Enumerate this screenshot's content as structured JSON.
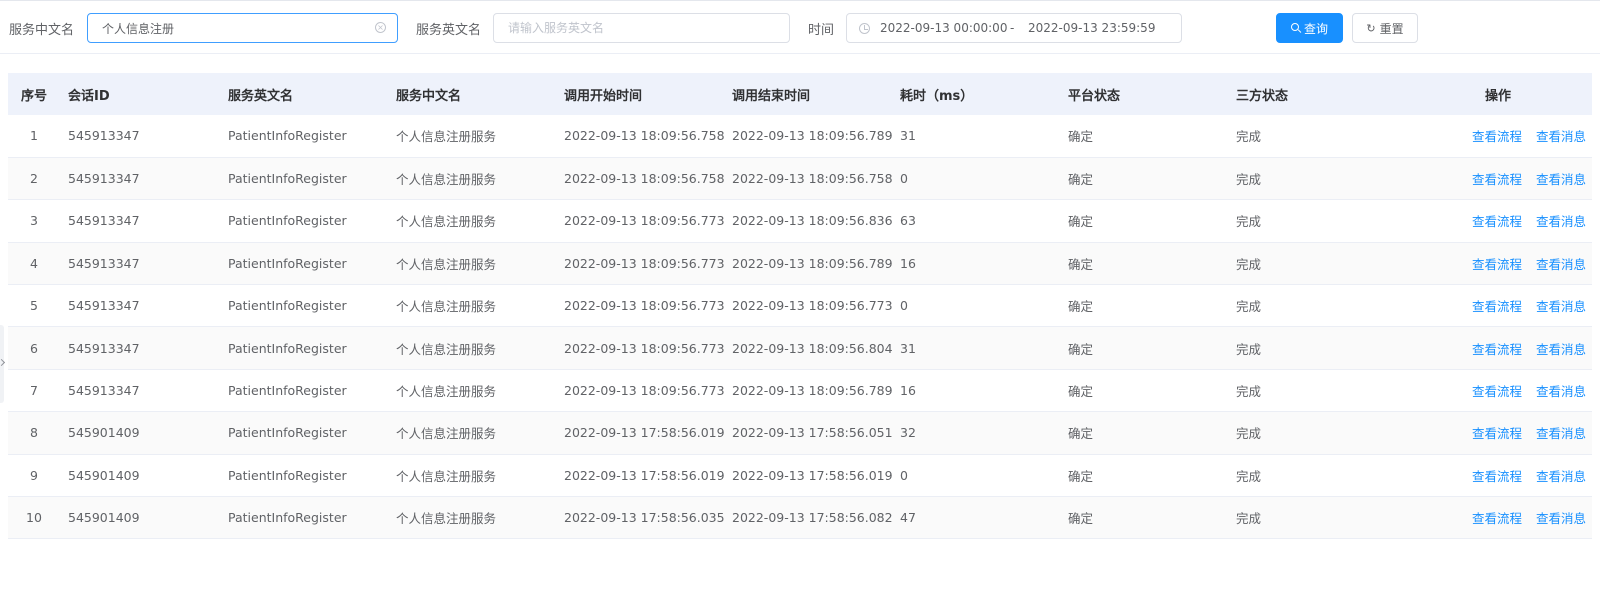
{
  "filters": {
    "cn_name_label": "服务中文名",
    "cn_name_value": "个人信息注册",
    "en_name_label": "服务英文名",
    "en_name_placeholder": "请输入服务英文名",
    "time_label": "时间",
    "time_start": "2022-09-13 00:00:00",
    "time_sep": "-",
    "time_end": "2022-09-13 23:59:59",
    "search_button": "查询",
    "reset_button": "重置",
    "reset_icon": "refresh-icon",
    "search_icon": "search-icon"
  },
  "table": {
    "columns": [
      "序号",
      "会话ID",
      "服务英文名",
      "服务中文名",
      "调用开始时间",
      "调用结束时间",
      "耗时（ms）",
      "平台状态",
      "三方状态",
      "操作"
    ],
    "rows": [
      {
        "idx": "1",
        "session": "545913347",
        "en": "PatientInfoRegister",
        "cn": "个人信息注册服务",
        "start": "2022-09-13 18:09:56.758",
        "end": "2022-09-13 18:09:56.789",
        "cost": "31",
        "platform": "确定",
        "third": "完成"
      },
      {
        "idx": "2",
        "session": "545913347",
        "en": "PatientInfoRegister",
        "cn": "个人信息注册服务",
        "start": "2022-09-13 18:09:56.758",
        "end": "2022-09-13 18:09:56.758",
        "cost": "0",
        "platform": "确定",
        "third": "完成"
      },
      {
        "idx": "3",
        "session": "545913347",
        "en": "PatientInfoRegister",
        "cn": "个人信息注册服务",
        "start": "2022-09-13 18:09:56.773",
        "end": "2022-09-13 18:09:56.836",
        "cost": "63",
        "platform": "确定",
        "third": "完成"
      },
      {
        "idx": "4",
        "session": "545913347",
        "en": "PatientInfoRegister",
        "cn": "个人信息注册服务",
        "start": "2022-09-13 18:09:56.773",
        "end": "2022-09-13 18:09:56.789",
        "cost": "16",
        "platform": "确定",
        "third": "完成"
      },
      {
        "idx": "5",
        "session": "545913347",
        "en": "PatientInfoRegister",
        "cn": "个人信息注册服务",
        "start": "2022-09-13 18:09:56.773",
        "end": "2022-09-13 18:09:56.773",
        "cost": "0",
        "platform": "确定",
        "third": "完成"
      },
      {
        "idx": "6",
        "session": "545913347",
        "en": "PatientInfoRegister",
        "cn": "个人信息注册服务",
        "start": "2022-09-13 18:09:56.773",
        "end": "2022-09-13 18:09:56.804",
        "cost": "31",
        "platform": "确定",
        "third": "完成"
      },
      {
        "idx": "7",
        "session": "545913347",
        "en": "PatientInfoRegister",
        "cn": "个人信息注册服务",
        "start": "2022-09-13 18:09:56.773",
        "end": "2022-09-13 18:09:56.789",
        "cost": "16",
        "platform": "确定",
        "third": "完成"
      },
      {
        "idx": "8",
        "session": "545901409",
        "en": "PatientInfoRegister",
        "cn": "个人信息注册服务",
        "start": "2022-09-13 17:58:56.019",
        "end": "2022-09-13 17:58:56.051",
        "cost": "32",
        "platform": "确定",
        "third": "完成"
      },
      {
        "idx": "9",
        "session": "545901409",
        "en": "PatientInfoRegister",
        "cn": "个人信息注册服务",
        "start": "2022-09-13 17:58:56.019",
        "end": "2022-09-13 17:58:56.019",
        "cost": "0",
        "platform": "确定",
        "third": "完成"
      },
      {
        "idx": "10",
        "session": "545901409",
        "en": "PatientInfoRegister",
        "cn": "个人信息注册服务",
        "start": "2022-09-13 17:58:56.035",
        "end": "2022-09-13 17:58:56.082",
        "cost": "47",
        "platform": "确定",
        "third": "完成"
      }
    ],
    "actions": {
      "view_flow": "查看流程",
      "view_message": "查看消息"
    }
  },
  "colors": {
    "primary": "#1890ff",
    "header_bg": "#eef2fb",
    "focus_border": "#409eff"
  }
}
